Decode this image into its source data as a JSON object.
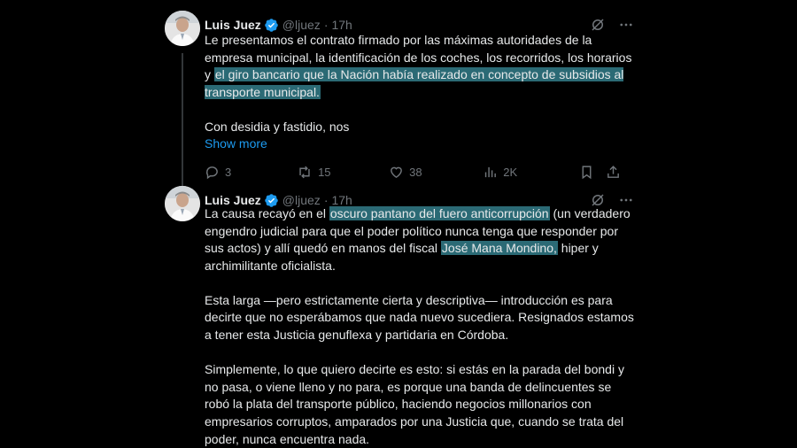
{
  "tweets": [
    {
      "author": {
        "name": "Luis Juez",
        "handle": "@ljuez"
      },
      "time": "17h",
      "separator": "·",
      "text": {
        "p1_a": "Le presentamos el contrato firmado por las máximas autoridades de la empresa municipal, la identificación de los coches, los recorridos, los horarios y ",
        "p1_hl": "el giro bancario que la Nación había realizado en concepto de subsidios al transporte municipal.",
        "p2": "Con desidia y fastidio, nos"
      },
      "show_more": "Show more",
      "stats": {
        "replies": "3",
        "reposts": "15",
        "likes": "38",
        "views": "2K"
      }
    },
    {
      "author": {
        "name": "Luis Juez",
        "handle": "@ljuez"
      },
      "time": "17h",
      "separator": "·",
      "text": {
        "p1_a": "La causa recayó en el ",
        "p1_hl1": "oscuro pantano del fuero anticorrupción",
        "p1_b": " (un verdadero engendro judicial para que el poder político nunca tenga que responder por sus actos) y allí quedó en manos del fiscal ",
        "p1_hl2": "José Mana Mondino,",
        "p1_c": " hiper y archimilitante oficialista.",
        "p2": "Esta larga —pero estrictamente cierta y descriptiva— introducción es para decirte que no esperábamos que nada nuevo sucediera. Resignados estamos a tener esta Justicia genuflexa y partidaria en Córdoba.",
        "p3": "Simplemente, lo que quiero decirte es esto: si estás en la parada del bondi y no pasa, o viene lleno y no para, es porque una banda de delincuentes se robó la plata del transporte público, haciendo negocios millonarios con empresarios corruptos, amparados por una Justicia que, cuando se trata del poder, nunca encuentra nada."
      }
    }
  ],
  "icons": {
    "verified": "verified-badge-icon",
    "grok": "grok-icon",
    "more": "more-horizontal-icon",
    "reply": "reply-icon",
    "repost": "repost-icon",
    "like": "like-icon",
    "views": "views-icon",
    "bookmark": "bookmark-icon",
    "share": "share-icon"
  },
  "colors": {
    "background": "#000000",
    "text": "#e7e9ea",
    "muted": "#71767b",
    "link": "#1d9bf0",
    "verified": "#1d9bf0",
    "highlight": "#2b6a75"
  }
}
